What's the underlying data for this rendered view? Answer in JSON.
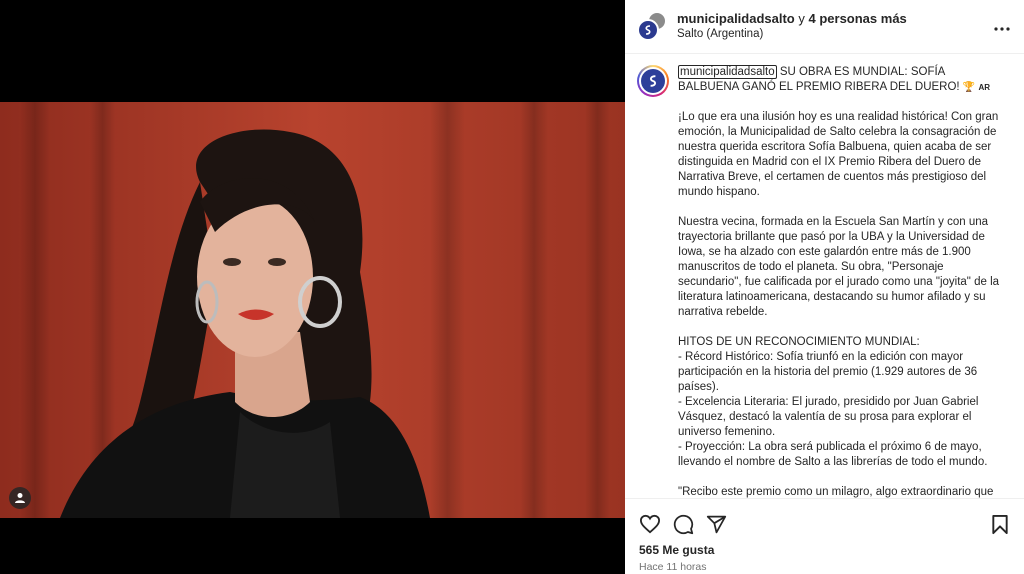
{
  "post": {
    "image_alt": "Retrato de Sofía Balbuena"
  },
  "header": {
    "username": "municipalidadsalto",
    "joiner": "y",
    "others": "4 personas más",
    "location": "Salto (Argentina)",
    "more_icon": "more-horizontal-icon"
  },
  "caption": {
    "username": "municipalidadsalto",
    "title": " SU OBRA ES MUNDIAL: SOFÍA BALBUENA GANÓ EL PREMIO RIBERA DEL DUERO! ",
    "trophy": "🏆",
    "flag_code": "AR",
    "paragraphs": [
      "¡Lo que era una ilusión hoy es una realidad histórica! Con gran emoción, la Municipalidad de Salto celebra la consagración de nuestra querida escritora Sofía Balbuena, quien acaba de ser distinguida en Madrid con el IX Premio Ribera del Duero de Narrativa Breve, el certamen de cuentos más prestigioso del mundo hispano.",
      "Nuestra vecina, formada en la Escuela San Martín y con una trayectoria brillante que pasó por la UBA y la Universidad de Iowa, se ha alzado con este galardón entre más de 1.900 manuscritos de todo el planeta. Su obra, \"Personaje secundario\", fue calificada por el jurado como una \"joyita\" de la literatura latinoamericana, destacando su humor afilado y su narrativa rebelde.",
      "HITOS DE UN RECONOCIMIENTO MUNDIAL:\n- Récord Histórico: Sofía triunfó en la edición con mayor participación en la historia del premio (1.929 autores de 36 países).\n- Excelencia Literaria: El jurado, presidido por Juan Gabriel Vásquez, destacó la valentía de su prosa para explorar el universo femenino.\n- Proyección: La obra será publicada el próximo 6 de mayo, llevando el nombre de Salto a las librerías de todo el mundo.",
      "\"Recibo este premio como un milagro, algo extraordinario que confirma una vocación de muchos años\", expresó Sofía desde el"
    ]
  },
  "actions": {
    "like_icon": "heart-icon",
    "comment_icon": "comment-icon",
    "share_icon": "share-icon",
    "save_icon": "bookmark-icon"
  },
  "likes_text": "565 Me gusta",
  "time_text": "Hace 11 horas",
  "colors": {
    "backdrop": "#000000",
    "photo_bg": "#a33a28",
    "text": "#262626",
    "muted": "#737373"
  }
}
